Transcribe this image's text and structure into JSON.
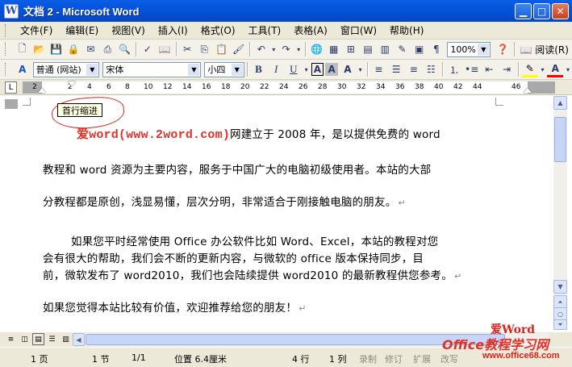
{
  "window": {
    "title": "文档 2 - Microsoft Word",
    "app_glyph": "W"
  },
  "menu": [
    "文件(F)",
    "编辑(E)",
    "视图(V)",
    "插入(I)",
    "格式(O)",
    "工具(T)",
    "表格(A)",
    "窗口(W)",
    "帮助(H)"
  ],
  "toolbar": {
    "zoom": "100%",
    "reading_label": "阅读(R)",
    "style": "普通 (网站)",
    "font": "宋体",
    "size": "小四"
  },
  "ruler": {
    "ticks": [
      "2",
      "2",
      "4",
      "6",
      "8",
      "10",
      "12",
      "14",
      "16",
      "18",
      "20",
      "22",
      "24",
      "26",
      "28",
      "30",
      "32",
      "34",
      "36",
      "38",
      "40",
      "42",
      "44",
      "46"
    ]
  },
  "tooltip": "首行缩进",
  "document": {
    "brand_mark": "爱",
    "brand_site": "word(www.2word.com)",
    "line1_rest": "网建立于 2008 年，是以提供免费的 word",
    "line2": "教程和 word 资源为主要内容，服务于中国广大的电脑初级使用者。本站的大部",
    "line3": "分教程都是原创，浅显易懂，层次分明，非常适合于刚接触电脑的朋友。",
    "line4": "如果您平时经常使用 Office 办公软件比如 Word、Excel，本站的教程对您",
    "line5": "会有很大的帮助，我们会不断的更新内容，与微软的 office 版本保持同步，目",
    "line6": "前，微软发布了 word2010，我们也会陆续提供 word2010 的最新教程供您参考。",
    "line7": "如果您觉得本站比较有价值，欢迎推荐给您的朋友！",
    "para_mark": "↵"
  },
  "status": {
    "page": "1 页",
    "section": "1 节",
    "pages": "1/1",
    "position": "位置 6.4厘米",
    "line": "4 行",
    "column": "1 列",
    "rec": "录制",
    "trk": "修订",
    "ext": "扩展",
    "ovr": "改写"
  },
  "watermark": {
    "mark": "爱",
    "word": "Word",
    "site_a": "Office",
    "site_b": "教程学习网",
    "url": "www.office68.com"
  }
}
